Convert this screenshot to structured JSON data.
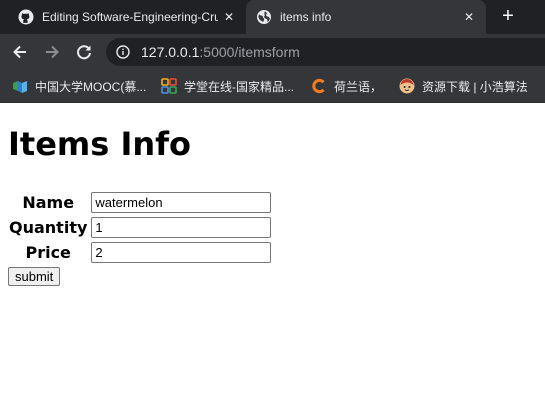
{
  "browser": {
    "tabs": [
      {
        "title": "Editing Software-Engineering-Cru",
        "active": false
      },
      {
        "title": "items info",
        "active": true
      }
    ],
    "new_tab_symbol": "+",
    "close_symbol": "✕",
    "address": {
      "host": "127.0.0.1",
      "rest": ":5000/itemsform"
    },
    "bookmarks": [
      {
        "label": "中国大学MOOC(慕...",
        "icon": "mooc-icon"
      },
      {
        "label": "学堂在线-国家精品...",
        "icon": "xuetang-icon"
      },
      {
        "label": "荷兰语，",
        "icon": "c-logo-icon",
        "color": "#f47a20"
      },
      {
        "label": "资源下载 | 小浩算法",
        "icon": "avatar-icon"
      }
    ]
  },
  "page": {
    "title": "Items Info",
    "fields": [
      {
        "label": "Name",
        "value": "watermelon"
      },
      {
        "label": "Quantity",
        "value": "1"
      },
      {
        "label": "Price",
        "value": "2"
      }
    ],
    "submit_label": "submit"
  }
}
